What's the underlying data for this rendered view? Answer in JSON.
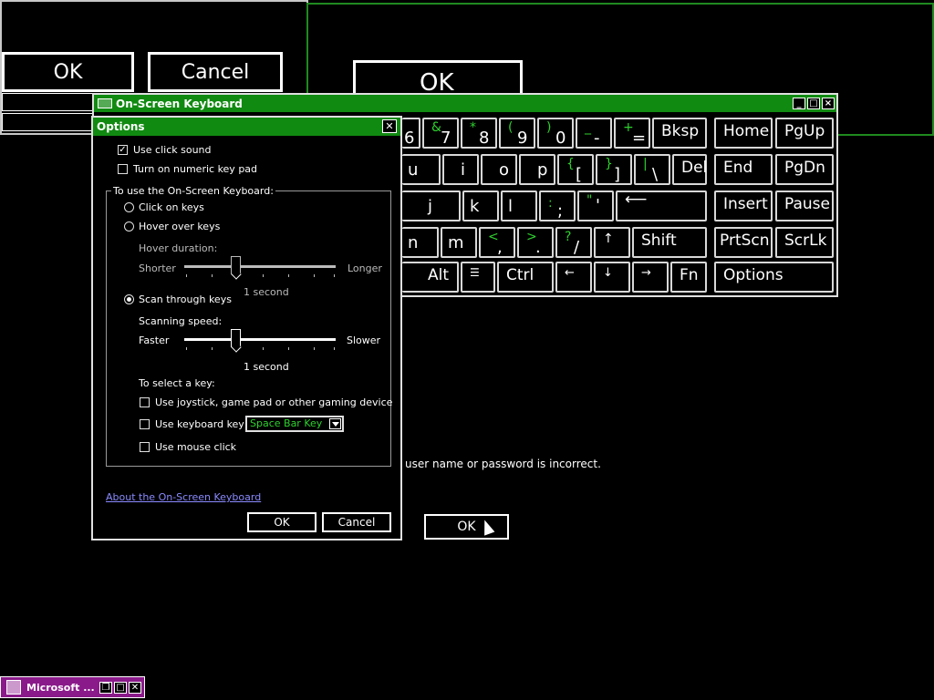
{
  "background_dialog": {
    "ok_label": "OK",
    "cancel_label": "Cancel",
    "big_ok_label": "OK",
    "error_text": "user name or password is incorrect.",
    "ok2_label": "OK"
  },
  "osk": {
    "title": "On-Screen Keyboard",
    "controls": [
      "_",
      "□",
      "×"
    ],
    "row1": [
      {
        "main": "6",
        "alt": ""
      },
      {
        "main": "7",
        "alt": "&"
      },
      {
        "main": "8",
        "alt": "*"
      },
      {
        "main": "9",
        "alt": "("
      },
      {
        "main": "0",
        "alt": ")"
      },
      {
        "main": "-",
        "alt": "_"
      },
      {
        "main": "=",
        "alt": "+"
      }
    ],
    "row2": [
      {
        "main": "u",
        "alt": ""
      },
      {
        "main": "i",
        "alt": ""
      },
      {
        "main": "o",
        "alt": ""
      },
      {
        "main": "p",
        "alt": ""
      },
      {
        "main": "[",
        "alt": "{"
      },
      {
        "main": "]",
        "alt": "}"
      },
      {
        "main": "\\",
        "alt": "|"
      }
    ],
    "row3": [
      {
        "main": "j",
        "alt": ""
      },
      {
        "main": "k",
        "alt": ""
      },
      {
        "main": "l",
        "alt": ""
      },
      {
        "main": ";",
        "alt": ":"
      },
      {
        "main": "'",
        "alt": "\""
      }
    ],
    "row4": [
      {
        "main": "n",
        "alt": ""
      },
      {
        "main": "m",
        "alt": ""
      },
      {
        "main": ",",
        "alt": "<"
      },
      {
        "main": ".",
        "alt": ">"
      },
      {
        "main": "/",
        "alt": "?"
      }
    ],
    "labels": {
      "bksp": "Bksp",
      "del": "Del",
      "enter": "⟵",
      "shift": "Shift",
      "up": "↑",
      "alt": "Alt",
      "menu": "☰",
      "ctrl": "Ctrl",
      "left": "←",
      "down": "↓",
      "right": "→",
      "fn": "Fn",
      "home": "Home",
      "pgup": "PgUp",
      "end": "End",
      "pgdn": "PgDn",
      "insert": "Insert",
      "pause": "Pause",
      "prtscn": "PrtScn",
      "scrlk": "ScrLk",
      "options": "Options"
    }
  },
  "options": {
    "title": "Options",
    "use_click_sound": "Use click sound",
    "numeric_keypad": "Turn on numeric key pad",
    "group_label": "To use the On-Screen Keyboard:",
    "click_on_keys": "Click on keys",
    "hover_over_keys": "Hover over keys",
    "hover_duration": "Hover duration:",
    "hover_left": "Shorter",
    "hover_right": "Longer",
    "hover_value": "1 second",
    "scan_through_keys": "Scan through keys",
    "scanning_speed": "Scanning speed:",
    "scan_left": "Faster",
    "scan_right": "Slower",
    "scan_value": "1 second",
    "select_key": "To select a key:",
    "use_joystick": "Use joystick, game pad or other gaming device",
    "use_keyboard_key": "Use keyboard key",
    "keyboard_key_value": "Space Bar Key",
    "use_mouse_click": "Use mouse click",
    "about_link": "About the On-Screen Keyboard",
    "ok_label": "OK",
    "cancel_label": "Cancel"
  },
  "taskbar": {
    "item_label": "Microsoft ..."
  },
  "colors": {
    "accent_green": "#118a11",
    "text_green": "#2ed12e",
    "taskbar_purple": "#8a1a8a"
  }
}
